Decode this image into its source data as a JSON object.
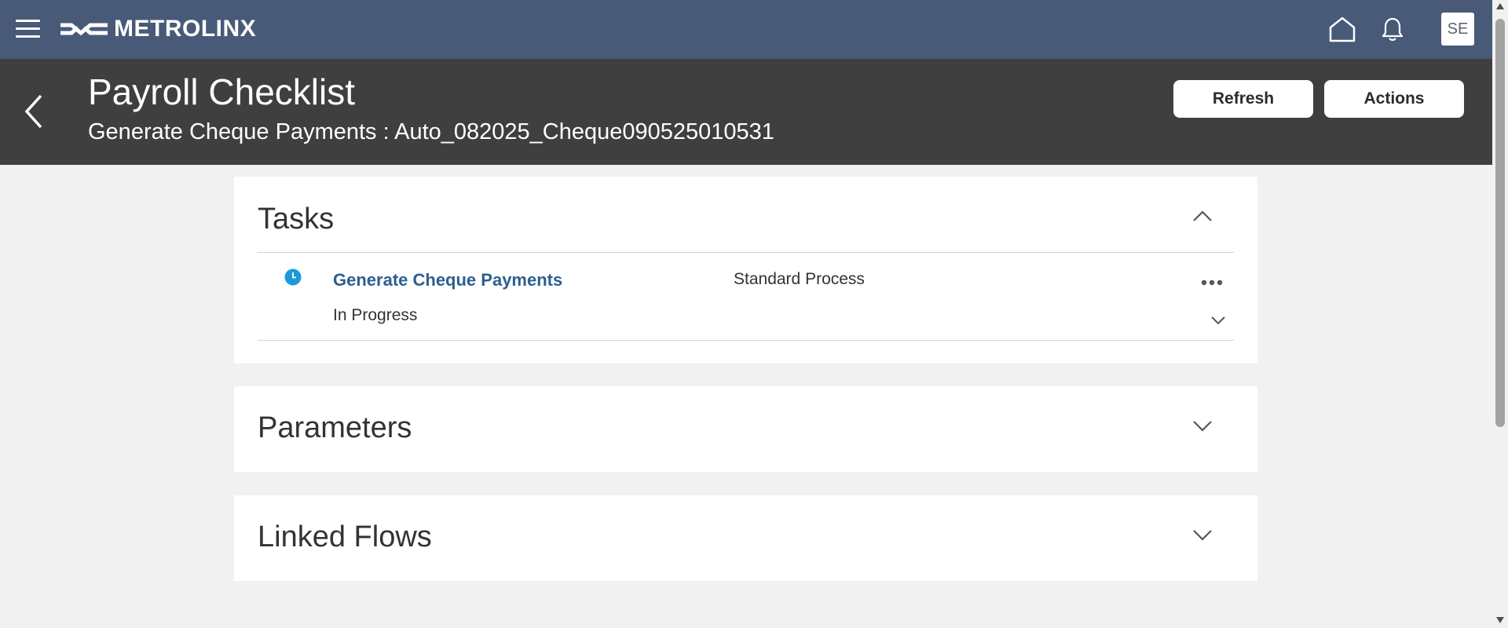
{
  "topbar": {
    "brand": "METROLINX",
    "user_initials": "SE",
    "bg_color": "#485a78"
  },
  "header": {
    "title": "Payroll Checklist",
    "subtitle": "Generate Cheque Payments : Auto_082025_Cheque090525010531",
    "refresh_label": "Refresh",
    "actions_label": "Actions"
  },
  "tasks": {
    "title": "Tasks",
    "items": [
      {
        "name": "Generate Cheque Payments",
        "type": "Standard Process",
        "status": "In Progress",
        "status_icon": "clock-icon",
        "status_color": "#1a9bd7"
      }
    ]
  },
  "parameters": {
    "title": "Parameters"
  },
  "linked_flows": {
    "title": "Linked Flows"
  },
  "icons": {
    "menu": "hamburger-icon",
    "home": "home-icon",
    "notifications": "bell-icon",
    "back": "chevron-left-icon",
    "more": "ellipsis-icon"
  }
}
